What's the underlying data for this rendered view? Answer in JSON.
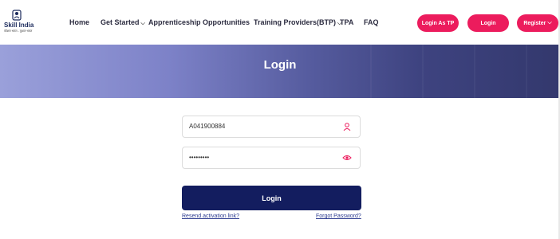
{
  "logo": {
    "title": "Skill India",
    "tagline": "कौशल भारत - कुशल भारत"
  },
  "nav": {
    "home": "Home",
    "get_started": "Get Started",
    "apprenticeship": "Apprenticeship Opportunities",
    "training_providers": "Training Providers(BTP)",
    "tpa": "TPA",
    "faq": "FAQ"
  },
  "header_buttons": {
    "login_as_tp": "Login As TP",
    "login": "Login",
    "register": "Register"
  },
  "banner": {
    "title": "Login"
  },
  "form": {
    "username_value": "A041900884",
    "password_value": "•••••••••",
    "submit_label": "Login",
    "resend_link": "Resend activation link?",
    "forgot_link": "Forgot Password?"
  },
  "colors": {
    "accent": "#ec1c5d",
    "primary": "#131d5f",
    "banner_dark": "#33386d"
  },
  "icons": {
    "user": "user-icon",
    "eye": "eye-icon",
    "chevron": "chevron-down-icon"
  }
}
